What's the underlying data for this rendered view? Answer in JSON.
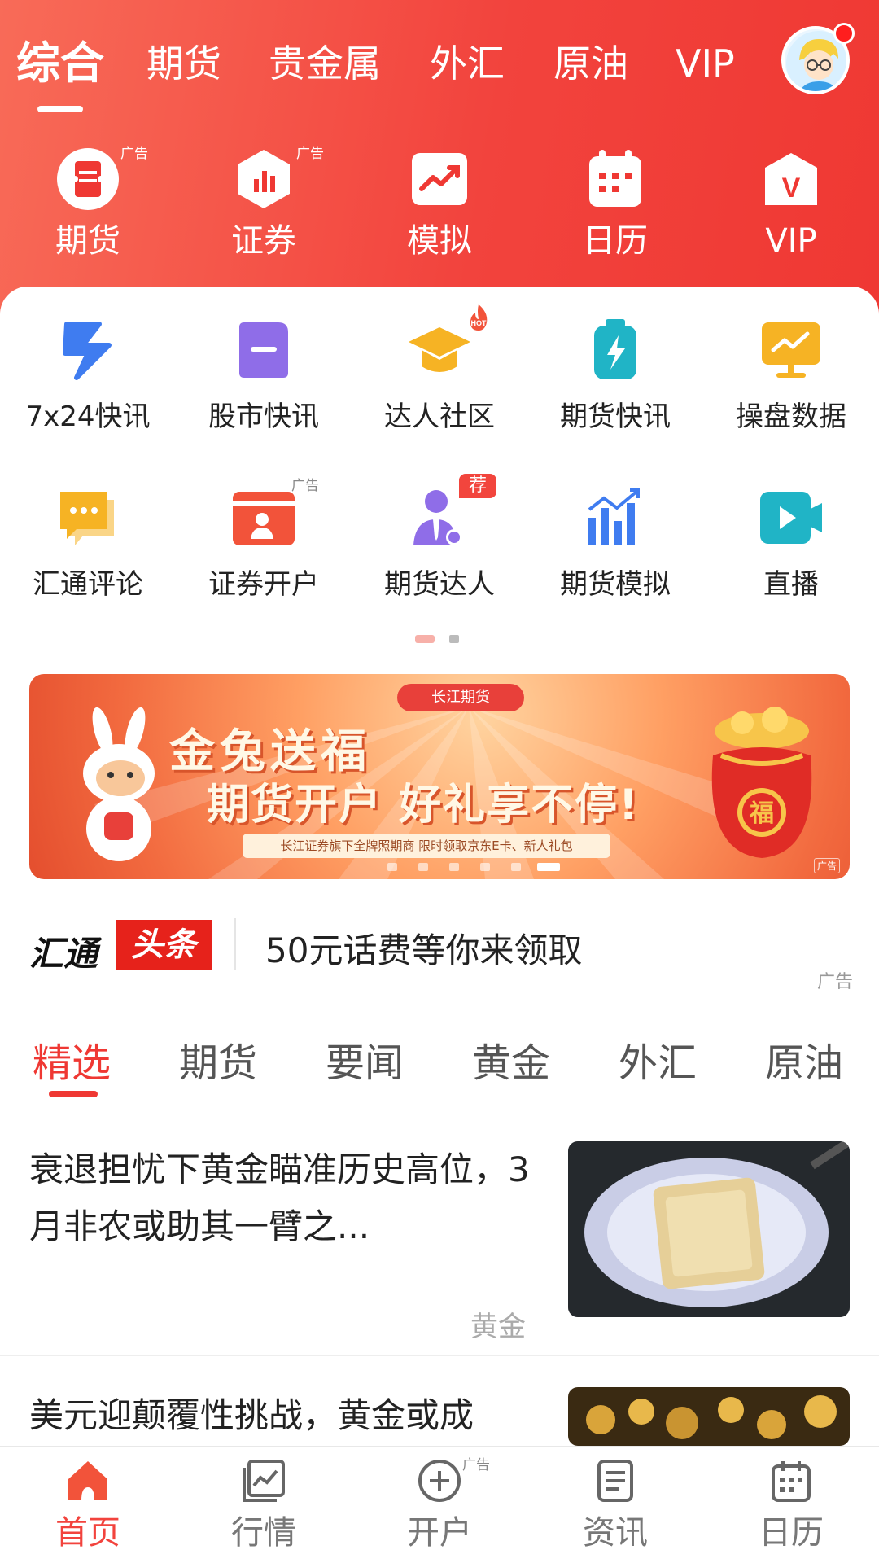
{
  "top_tabs": [
    "综合",
    "期货",
    "贵金属",
    "外汇",
    "原油",
    "VIP"
  ],
  "quick_actions": [
    {
      "label": "期货",
      "icon": "ticket-icon",
      "ad": "广告"
    },
    {
      "label": "证券",
      "icon": "bar-chart-hexagon-icon",
      "ad": "广告"
    },
    {
      "label": "模拟",
      "icon": "trend-up-icon",
      "ad": ""
    },
    {
      "label": "日历",
      "icon": "calendar-icon",
      "ad": ""
    },
    {
      "label": "VIP",
      "icon": "vip-bag-icon",
      "ad": ""
    }
  ],
  "grid": [
    {
      "label": "7x24快讯",
      "icon": "lightning-icon",
      "color": "#3f7cf0"
    },
    {
      "label": "股市快讯",
      "icon": "message-bubble-icon",
      "color": "#8f6de8"
    },
    {
      "label": "达人社区",
      "icon": "graduation-cap-icon",
      "color": "#f6b324"
    },
    {
      "label": "期货快讯",
      "icon": "battery-bolt-icon",
      "color": "#20b4c6"
    },
    {
      "label": "操盘数据",
      "icon": "monitor-chart-icon",
      "color": "#f6b324"
    },
    {
      "label": "汇通评论",
      "icon": "chat-bubble-icon",
      "color": "#f6b324"
    },
    {
      "label": "证券开户",
      "icon": "id-card-icon",
      "color": "#f2533a"
    },
    {
      "label": "期货达人",
      "icon": "expert-person-icon",
      "color": "#8f6de8"
    },
    {
      "label": "期货模拟",
      "icon": "bar-graph-icon",
      "color": "#3f7cf0"
    },
    {
      "label": "直播",
      "icon": "video-play-icon",
      "color": "#20b4c6"
    }
  ],
  "badges": {
    "hot": "HOT",
    "recommend": "荐",
    "ad": "广告"
  },
  "banner": {
    "brand": "长江期货",
    "title": "金兔送福",
    "subtitle": "期货开户 好礼享不停!",
    "note": "长江证券旗下全牌照期商 限时领取京东E卡、新人礼包",
    "seal": "福",
    "ad": "广告"
  },
  "headline": {
    "brand": "汇通",
    "tag": "头条",
    "text": "50元话费等你来领取",
    "ad": "广告"
  },
  "category_tabs": [
    "精选",
    "期货",
    "要闻",
    "黄金",
    "外汇",
    "原油"
  ],
  "news": [
    {
      "title": "衰退担忧下黄金瞄准历史高位，3月非农或助其一臂之...",
      "tag": "黄金"
    },
    {
      "title": "美元迎颠覆性挑战，黄金或成",
      "tag": ""
    }
  ],
  "bottom_nav": [
    {
      "label": "首页",
      "icon": "home-icon",
      "active": true
    },
    {
      "label": "行情",
      "icon": "market-chart-icon",
      "active": false
    },
    {
      "label": "开户",
      "icon": "plus-circle-icon",
      "active": false,
      "ad": "广告"
    },
    {
      "label": "资讯",
      "icon": "news-doc-icon",
      "active": false
    },
    {
      "label": "日历",
      "icon": "calendar-icon",
      "active": false
    }
  ],
  "colors": {
    "brand_red": "#ef3833",
    "active_red": "#f2433d"
  }
}
